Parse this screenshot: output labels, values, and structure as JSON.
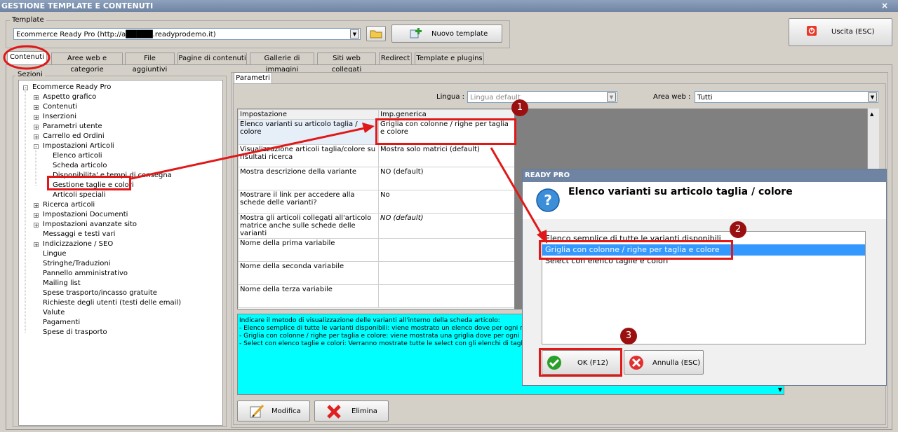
{
  "window": {
    "title": "GESTIONE TEMPLATE E CONTENUTI",
    "close": "×"
  },
  "template_group": {
    "legend": "Template",
    "selected": "Ecommerce Ready Pro (http://a█████.readyprodemo.it)",
    "new_button": "Nuovo template"
  },
  "exit_button": "Uscita (ESC)",
  "tabs": [
    "Contenuti",
    "Aree web e categorie",
    "File aggiuntivi",
    "Pagine di contenuti",
    "Gallerie di immagini",
    "Siti web collegati",
    "Redirect",
    "Template e plugins"
  ],
  "sections_legend": "Sezioni",
  "tree": [
    {
      "label": "Ecommerce Ready Pro",
      "sign": "-"
    },
    {
      "label": "Aspetto grafico",
      "sign": "+"
    },
    {
      "label": "Contenuti",
      "sign": "+"
    },
    {
      "label": "Inserzioni",
      "sign": "+"
    },
    {
      "label": "Parametri utente",
      "sign": "+"
    },
    {
      "label": "Carrello ed Ordini",
      "sign": "+"
    },
    {
      "label": "Impostazioni Articoli",
      "sign": "-"
    },
    {
      "label": "Elenco articoli",
      "sign": ""
    },
    {
      "label": "Scheda articolo",
      "sign": ""
    },
    {
      "label": "Disponibilita' e tempi di consegna",
      "sign": ""
    },
    {
      "label": "Gestione taglie e colori",
      "sign": ""
    },
    {
      "label": "Articoli speciali",
      "sign": ""
    },
    {
      "label": "Ricerca articoli",
      "sign": "+"
    },
    {
      "label": "Impostazioni Documenti",
      "sign": "+"
    },
    {
      "label": "Impostazioni avanzate sito",
      "sign": "+"
    },
    {
      "label": "Messaggi e testi vari",
      "sign": ""
    },
    {
      "label": "Indicizzazione / SEO",
      "sign": "+"
    },
    {
      "label": "Lingue",
      "sign": ""
    },
    {
      "label": "Stringhe/Traduzioni",
      "sign": ""
    },
    {
      "label": "Pannello amministrativo",
      "sign": ""
    },
    {
      "label": "Mailing list",
      "sign": ""
    },
    {
      "label": "Spese trasporto/incasso gratuite",
      "sign": ""
    },
    {
      "label": "Richieste degli utenti (testi delle email)",
      "sign": ""
    },
    {
      "label": "Valute",
      "sign": ""
    },
    {
      "label": "Pagamenti",
      "sign": ""
    },
    {
      "label": "Spese di trasporto",
      "sign": ""
    }
  ],
  "params": {
    "tab": "Parametri",
    "lingua_label": "Lingua :",
    "lingua_value": "Lingua default",
    "area_label": "Area web :",
    "area_value": "Tutti",
    "col_setting": "Impostazione",
    "col_value": "Imp.generica",
    "rows": [
      {
        "setting": "Elenco varianti su articolo taglia / colore",
        "value": "Griglia con colonne / righe per taglia e colore"
      },
      {
        "setting": "Visualizzazione articoli taglia/colore su risultati ricerca",
        "value": "Mostra solo matrici (default)"
      },
      {
        "setting": "Mostra descrizione della variante",
        "value": "NO (default)"
      },
      {
        "setting": "Mostrare il link per accedere alla schede delle varianti?",
        "value": "No"
      },
      {
        "setting": "Mostra gli articoli collegati all'articolo matrice anche sulle schede delle varianti",
        "value": "NO (default)"
      },
      {
        "setting": "Nome della prima variabile",
        "value": ""
      },
      {
        "setting": "Nome della seconda variabile",
        "value": ""
      },
      {
        "setting": "Nome della terza variabile",
        "value": ""
      }
    ],
    "description": [
      "Indicare il metodo di visualizzazione delle varianti all'interno della scheda articolo:",
      "- Elenco semplice di tutte le varianti disponibili: viene mostrato un elenco dove per ogni rig",
      "- Griglia con colonne / righe per taglia e colore: viene mostrata una griglia dove per ogni",
      "- Select con elenco taglie e colori: Verranno mostrate tutte le select con gli elenchi di taglie"
    ],
    "edit_button": "Modifica",
    "delete_button": "Elimina"
  },
  "dialog": {
    "title": "READY PRO",
    "heading": "Elenco varianti su articolo taglia / colore",
    "options": [
      "Elenco semplice di tutte le varianti disponibili",
      "Griglia con colonne / righe per taglia e colore",
      "Select con elenco taglie e colori"
    ],
    "ok": "OK (F12)",
    "cancel": "Annulla (ESC)"
  },
  "badges": [
    "1",
    "2",
    "3"
  ],
  "colors": {
    "accent_red": "#e01818",
    "selection": "#3399ff",
    "desc_bg": "#00ffff"
  }
}
